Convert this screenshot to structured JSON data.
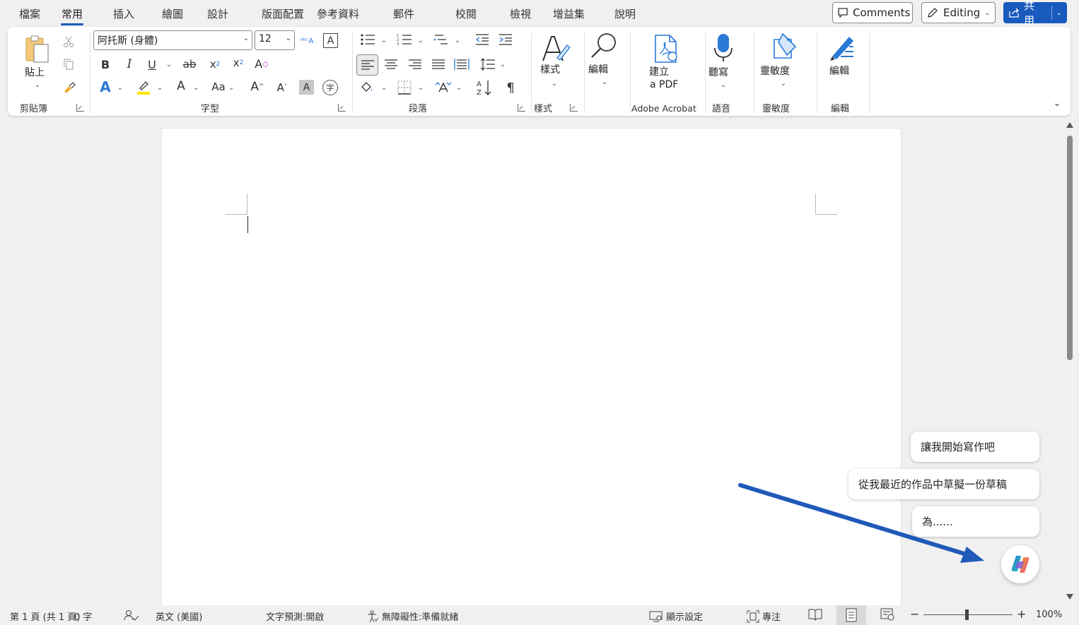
{
  "menu": {
    "tabs": [
      "檔案",
      "常用",
      "插入",
      "繪圖",
      "設計",
      "版面配置",
      "參考資料",
      "郵件",
      "校閱",
      "檢視",
      "增益集",
      "說明"
    ],
    "active": "常用",
    "comments_label": "Comments",
    "editing_label": "Editing",
    "share_label": "共用"
  },
  "ribbon": {
    "clipboard": {
      "paste_label": "貼上",
      "group_label": "剪貼簿"
    },
    "font": {
      "font_name": "阿托斯 (身體)",
      "font_size": "12",
      "group_label": "字型"
    },
    "paragraph": {
      "group_label": "段落"
    },
    "styles": {
      "button_label": "樣式",
      "group_label": "樣式"
    },
    "editing": {
      "button_label": "編輯"
    },
    "acrobat": {
      "button_line1": "建立",
      "button_line2": "a PDF",
      "group_label": "Adobe Acrobat"
    },
    "voice": {
      "button_label": "聽寫",
      "group_label": "語音"
    },
    "sensitivity": {
      "button_label": "靈敏度",
      "group_label": "靈敏度"
    },
    "editor": {
      "button_label": "編輯",
      "group_label": "編輯"
    }
  },
  "copilot": {
    "suggestions": [
      "讓我開始寫作吧",
      "從我最近的作品中草擬一份草稿",
      "為......"
    ]
  },
  "statusbar": {
    "page_info": "第 1 頁 (共 1 頁)",
    "word_count": "0 字",
    "language": "英文 (美國)",
    "text_prediction": "文字預測:開啟",
    "accessibility": "無障礙性:準備就緒",
    "display_settings": "顯示設定",
    "focus": "專注",
    "zoom": "100%"
  },
  "colors": {
    "accent": "#185abd",
    "annotation_arrow": "#1f5ab8"
  }
}
